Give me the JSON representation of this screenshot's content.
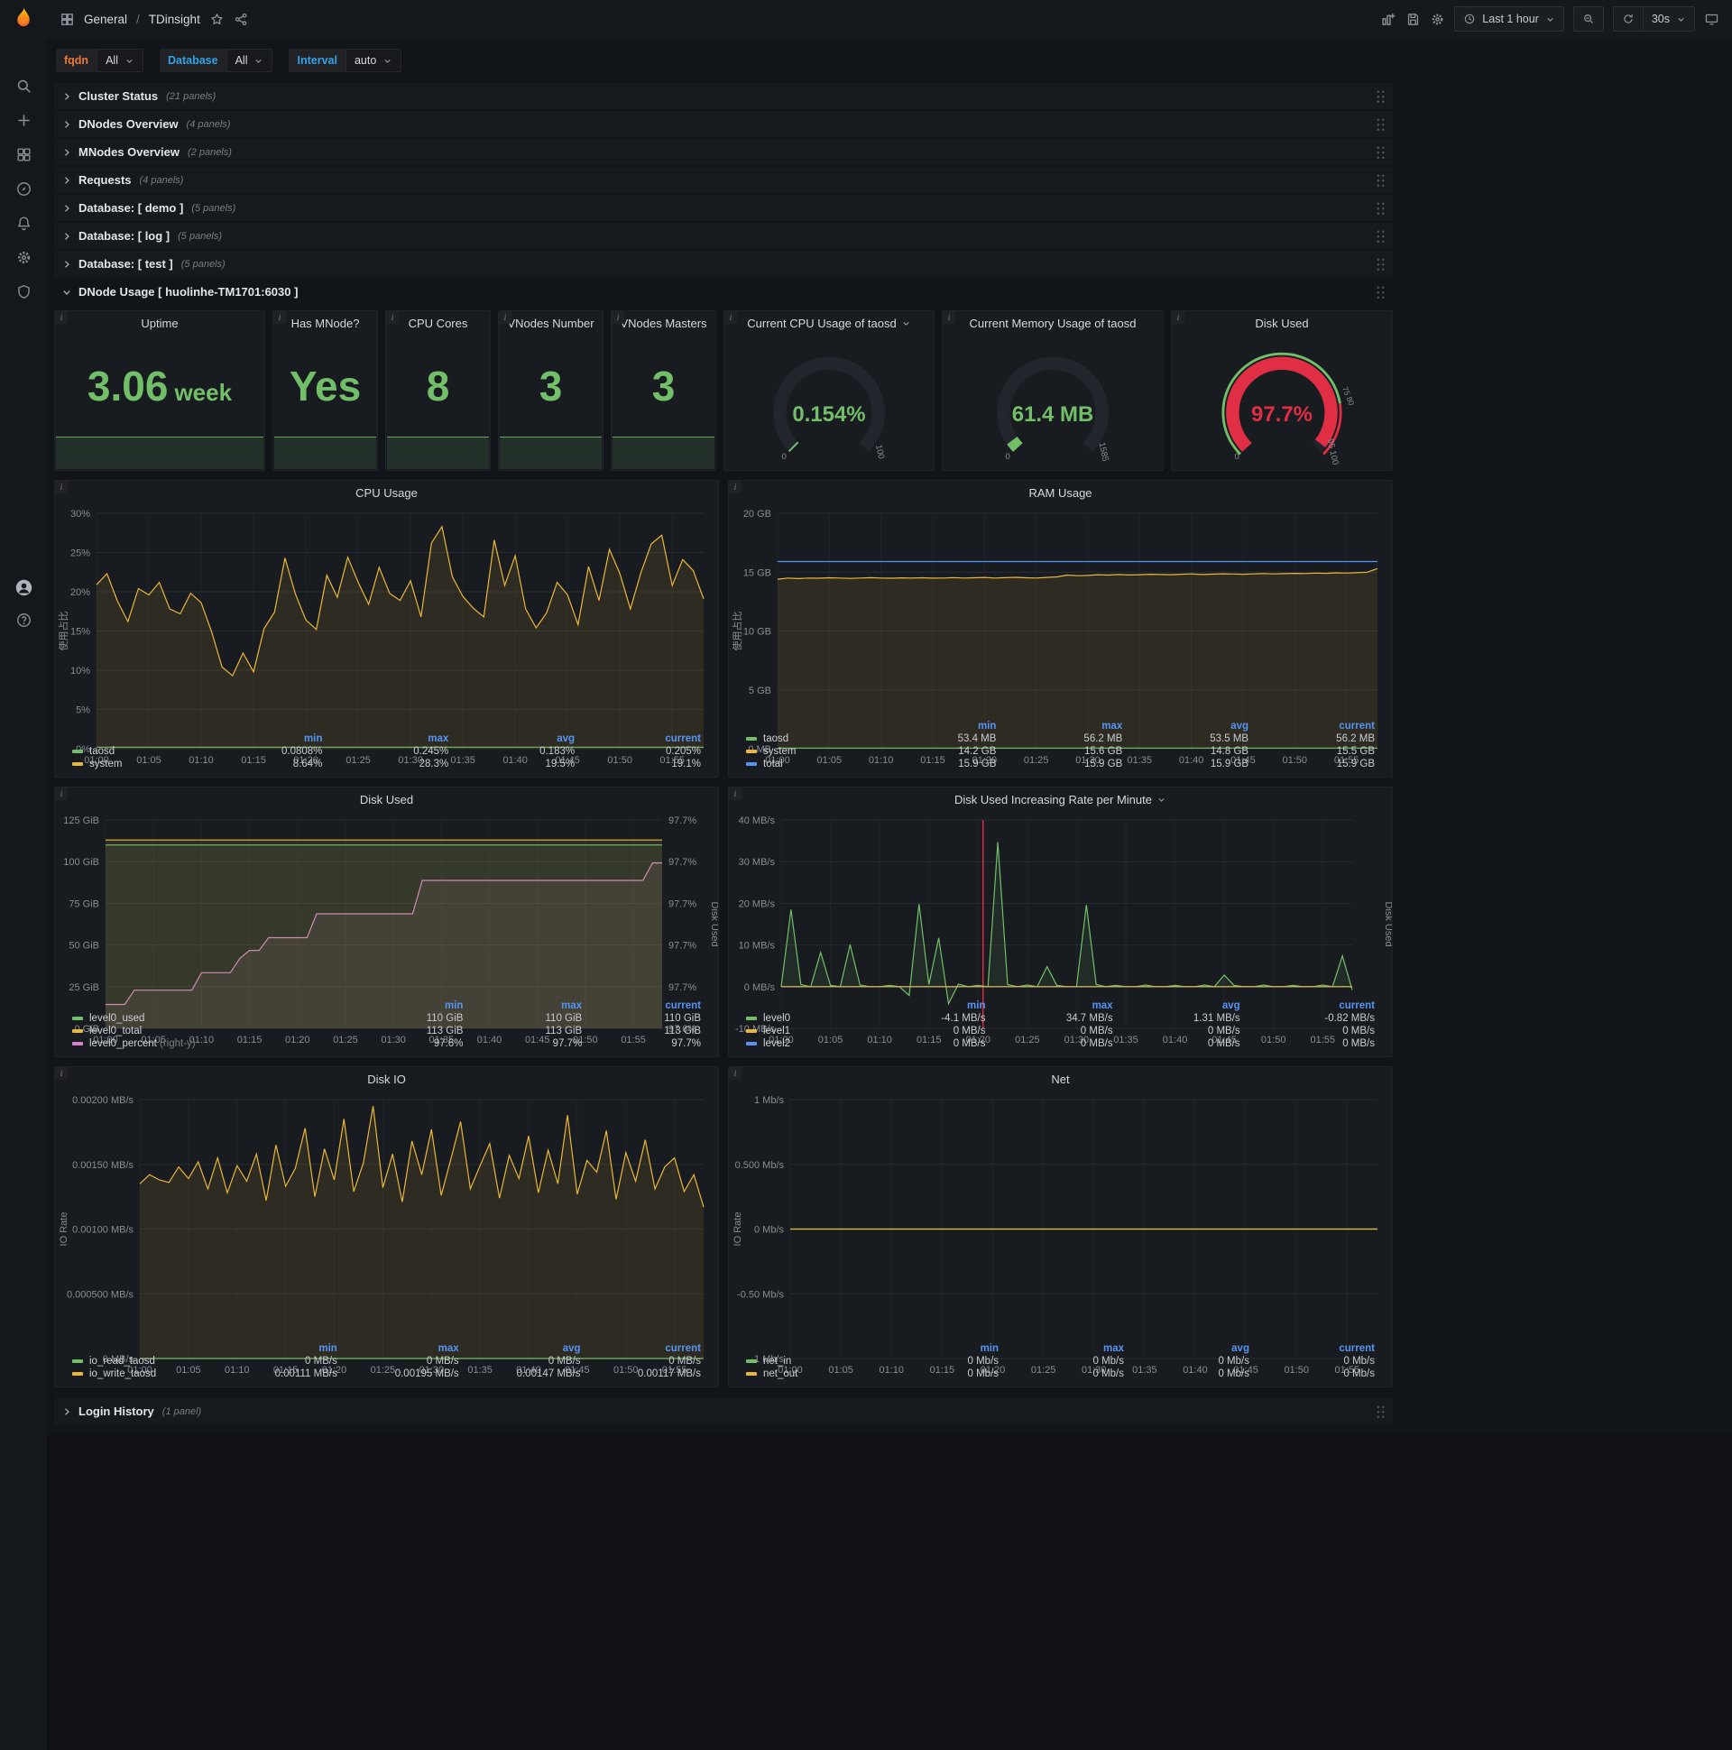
{
  "app": {
    "breadcrumb": {
      "section": "General",
      "separator": "/",
      "page": "TDinsight"
    },
    "toolbar": {
      "time_range": "Last 1 hour",
      "refresh": "30s"
    }
  },
  "variables": [
    {
      "name": "fqdn",
      "value": "All",
      "color": "#eb7b35"
    },
    {
      "name": "Database",
      "value": "All",
      "color": "#33a2e5"
    },
    {
      "name": "Interval",
      "value": "auto",
      "color": "#33a2e5"
    }
  ],
  "collapsed_rows": [
    {
      "title": "Cluster Status",
      "count": "(21 panels)"
    },
    {
      "title": "DNodes Overview",
      "count": "(4 panels)"
    },
    {
      "title": "MNodes Overview",
      "count": "(2 panels)"
    },
    {
      "title": "Requests",
      "count": "(4 panels)"
    },
    {
      "title": "Database: [ demo ]",
      "count": "(5 panels)"
    },
    {
      "title": "Database: [ log ]",
      "count": "(5 panels)"
    },
    {
      "title": "Database: [ test ]",
      "count": "(5 panels)"
    }
  ],
  "expanded_row": {
    "title": "DNode Usage [ huolinhe-TM1701:6030 ]"
  },
  "bottom_row": {
    "title": "Login History",
    "count": "(1 panel)"
  },
  "stats": [
    {
      "title": "Uptime",
      "value": "3.06",
      "suffix": "week"
    },
    {
      "title": "Has MNode?",
      "value": "Yes",
      "suffix": ""
    },
    {
      "title": "CPU Cores",
      "value": "8",
      "suffix": ""
    },
    {
      "title": "VNodes Number",
      "value": "3",
      "suffix": ""
    },
    {
      "title": "VNodes Masters",
      "value": "3",
      "suffix": ""
    }
  ],
  "gauges": [
    {
      "title": "Current CPU Usage of taosd",
      "value": "0.154%",
      "fraction": 0.008,
      "color": "#73bf69",
      "min_label": "0",
      "max_label": "100"
    },
    {
      "title": "Current Memory Usage of taosd",
      "value": "61.4 MB",
      "fraction": 0.039,
      "color": "#73bf69",
      "min_label": "0",
      "max_label": "1585"
    },
    {
      "title": "Disk Used",
      "value": "97.7%",
      "fraction": 0.977,
      "color": "#e02f44",
      "min_label": "0",
      "max_label": "95 100",
      "mid_label": "75 80",
      "threshold_band": true
    }
  ],
  "time_axis": {
    "ticks": [
      "01:00",
      "01:05",
      "01:10",
      "01:15",
      "01:20",
      "01:25",
      "01:30",
      "01:35",
      "01:40",
      "01:45",
      "01:50",
      "01:55"
    ],
    "span_minutes": 58,
    "tick_step": 5
  },
  "charts": {
    "cpu": {
      "type": "line",
      "title": "CPU Usage",
      "ylabel": "使用占比",
      "ymin": 0,
      "ymax": 30,
      "y_ticks": [
        "0%",
        "5%",
        "10%",
        "15%",
        "20%",
        "25%",
        "30%"
      ],
      "series": [
        {
          "name": "system",
          "color": "#eab839",
          "fill": true,
          "values": [
            20.9,
            22.3,
            18.8,
            16.2,
            20.4,
            19.6,
            21.2,
            17.8,
            17.2,
            19.8,
            18.6,
            14.9,
            10.4,
            9.3,
            12.2,
            9.8,
            15.3,
            17.4,
            24.3,
            19.7,
            16.4,
            15.2,
            22.1,
            19.3,
            24.4,
            21.2,
            18.4,
            23.1,
            19.8,
            18.9,
            21.4,
            16.8,
            26.2,
            28.3,
            21.9,
            19.4,
            17.9,
            16.8,
            26.6,
            20.8,
            24.6,
            17.8,
            15.4,
            17.3,
            21.2,
            19.6,
            15.8,
            23.2,
            18.9,
            25.4,
            22.3,
            17.8,
            22.4,
            26.1,
            27.2,
            20.8,
            24.1,
            22.7,
            19.1
          ]
        },
        {
          "name": "taosd",
          "color": "#73bf69",
          "flat": 0.2
        }
      ],
      "legend": {
        "cols": [
          "min",
          "max",
          "avg",
          "current"
        ],
        "rows": [
          {
            "name": "taosd",
            "color": "#73bf69",
            "vals": [
              "0.0808%",
              "0.245%",
              "0.183%",
              "0.205%"
            ]
          },
          {
            "name": "system",
            "color": "#eab839",
            "vals": [
              "8.64%",
              "28.3%",
              "19.5%",
              "19.1%"
            ]
          }
        ]
      }
    },
    "ram": {
      "type": "line",
      "title": "RAM Usage",
      "ylabel": "使用占比",
      "ymin": 0,
      "ymax": 20,
      "y_ticks": [
        "0 MB",
        "5 GB",
        "10 GB",
        "15 GB",
        "20 GB"
      ],
      "series": [
        {
          "name": "system",
          "color": "#eab839",
          "fill": true,
          "values": [
            14.4,
            14.5,
            14.45,
            14.5,
            14.48,
            14.52,
            14.5,
            14.47,
            14.5,
            14.53,
            14.5,
            14.48,
            14.51,
            14.5,
            14.52,
            14.49,
            14.5,
            14.54,
            14.5,
            14.52,
            14.55,
            14.5,
            14.53,
            14.56,
            14.52,
            14.5,
            14.55,
            14.6,
            14.75,
            14.7,
            14.72,
            14.78,
            14.75,
            14.8,
            14.76,
            14.78,
            14.82,
            14.8,
            14.78,
            14.82,
            14.85,
            14.8,
            14.83,
            14.86,
            14.84,
            14.82,
            14.85,
            14.88,
            14.85,
            14.87,
            14.9,
            14.88,
            14.92,
            14.9,
            14.94,
            14.92,
            14.95,
            15.0,
            15.3
          ]
        },
        {
          "name": "total",
          "color": "#5794f2",
          "flat": 15.9
        },
        {
          "name": "taosd",
          "color": "#73bf69",
          "flat": 0.055
        }
      ],
      "legend": {
        "cols": [
          "min",
          "max",
          "avg",
          "current"
        ],
        "rows": [
          {
            "name": "taosd",
            "color": "#73bf69",
            "vals": [
              "53.4 MB",
              "56.2 MB",
              "53.5 MB",
              "56.2 MB"
            ]
          },
          {
            "name": "system",
            "color": "#eab839",
            "vals": [
              "14.2 GB",
              "15.6 GB",
              "14.8 GB",
              "15.5 GB"
            ]
          },
          {
            "name": "total",
            "color": "#5794f2",
            "vals": [
              "15.9 GB",
              "15.9 GB",
              "15.9 GB",
              "15.9 GB"
            ]
          }
        ]
      }
    },
    "disk": {
      "type": "line",
      "title": "Disk Used",
      "ymin": 0,
      "ymax": 125,
      "y_ticks": [
        "0 GiB",
        "25 GiB",
        "50 GiB",
        "75 GiB",
        "100 GiB",
        "125 GiB"
      ],
      "y_ticks_right": [
        "97.6%",
        "97.7%",
        "97.7%",
        "97.7%",
        "97.7%",
        "97.7%"
      ],
      "right_label": "Disk Used",
      "series": [
        {
          "name": "level0_percent",
          "color": "#d683ce",
          "fill": true,
          "ymin": 97.597,
          "ymax": 97.728,
          "values": [
            97.612,
            97.612,
            97.612,
            97.621,
            97.621,
            97.621,
            97.621,
            97.621,
            97.621,
            97.621,
            97.632,
            97.632,
            97.632,
            97.632,
            97.641,
            97.646,
            97.646,
            97.654,
            97.654,
            97.654,
            97.654,
            97.654,
            97.669,
            97.669,
            97.669,
            97.669,
            97.669,
            97.669,
            97.669,
            97.669,
            97.669,
            97.669,
            97.669,
            97.69,
            97.69,
            97.69,
            97.69,
            97.69,
            97.69,
            97.69,
            97.69,
            97.69,
            97.69,
            97.69,
            97.69,
            97.69,
            97.69,
            97.69,
            97.69,
            97.69,
            97.69,
            97.69,
            97.69,
            97.69,
            97.69,
            97.69,
            97.69,
            97.701,
            97.701
          ]
        },
        {
          "name": "level0_used",
          "color": "#73bf69",
          "fill": true,
          "flat": 110
        },
        {
          "name": "level0_total",
          "color": "#eab839",
          "fill": true,
          "flat": 113
        }
      ],
      "legend": {
        "cols": [
          "min",
          "max",
          "current"
        ],
        "rows": [
          {
            "name": "level0_used",
            "color": "#73bf69",
            "vals": [
              "110 GiB",
              "110 GiB",
              "110 GiB"
            ]
          },
          {
            "name": "level0_total",
            "color": "#eab839",
            "vals": [
              "113 GiB",
              "113 GiB",
              "113 GiB"
            ]
          },
          {
            "name": "level0_percent",
            "note": "(right-y)",
            "color": "#d683ce",
            "vals": [
              "97.6%",
              "97.7%",
              "97.7%"
            ]
          }
        ]
      }
    },
    "rate": {
      "type": "line",
      "title": "Disk Used Increasing Rate per Minute",
      "ymin": -10,
      "ymax": 40,
      "y_ticks": [
        "-10 MB/s",
        "0 MB/s",
        "10 MB/s",
        "20 MB/s",
        "30 MB/s",
        "40 MB/s"
      ],
      "right_label": "Disk Used",
      "annotation_x": 20.5,
      "series": [
        {
          "name": "level0",
          "color": "#73bf69",
          "fill": true,
          "values": [
            0,
            18.5,
            0.5,
            0,
            8.2,
            0.3,
            0,
            10.1,
            0.4,
            0,
            0,
            0.3,
            0,
            -2.1,
            19.8,
            0.5,
            11.7,
            -4.1,
            0.6,
            0,
            0.3,
            0,
            34.7,
            0.5,
            0,
            0.4,
            0,
            4.8,
            0.3,
            0,
            0,
            19.6,
            0.5,
            0,
            0.3,
            0,
            0,
            0.4,
            0,
            0,
            0.3,
            0,
            0,
            0.4,
            0,
            2.8,
            0.3,
            0,
            0,
            0.4,
            0,
            0,
            0.3,
            0,
            0,
            0.4,
            0,
            7.4,
            -0.82
          ]
        },
        {
          "name": "level2",
          "color": "#5794f2",
          "flat": 0
        },
        {
          "name": "level1",
          "color": "#eab839",
          "flat": 0
        }
      ],
      "legend": {
        "cols": [
          "min",
          "max",
          "avg",
          "current"
        ],
        "rows": [
          {
            "name": "level0",
            "color": "#73bf69",
            "vals": [
              "-4.1 MB/s",
              "34.7 MB/s",
              "1.31 MB/s",
              "-0.82 MB/s"
            ]
          },
          {
            "name": "level1",
            "color": "#eab839",
            "vals": [
              "0 MB/s",
              "0 MB/s",
              "0 MB/s",
              "0 MB/s"
            ]
          },
          {
            "name": "level2",
            "color": "#5794f2",
            "vals": [
              "0 MB/s",
              "0 MB/s",
              "0 MB/s",
              "0 MB/s"
            ]
          }
        ]
      }
    },
    "diskio": {
      "type": "line",
      "title": "Disk IO",
      "ylabel": "IO Rate",
      "ymin": 0,
      "ymax": 0.002,
      "y_ticks": [
        "0 MB/s",
        "0.000500 MB/s",
        "0.00100 MB/s",
        "0.00150 MB/s",
        "0.00200 MB/s"
      ],
      "series": [
        {
          "name": "io_write_taosd",
          "color": "#eab839",
          "fill": true,
          "values": [
            0.00135,
            0.00142,
            0.00138,
            0.00136,
            0.00148,
            0.00139,
            0.00152,
            0.00131,
            0.00155,
            0.00128,
            0.00149,
            0.00137,
            0.00158,
            0.00122,
            0.00165,
            0.00133,
            0.00147,
            0.00178,
            0.00125,
            0.00162,
            0.00138,
            0.00185,
            0.00129,
            0.00151,
            0.00195,
            0.00132,
            0.00158,
            0.00121,
            0.00168,
            0.00142,
            0.00177,
            0.00126,
            0.00154,
            0.00183,
            0.00131,
            0.00149,
            0.00166,
            0.00124,
            0.00157,
            0.00139,
            0.00172,
            0.00128,
            0.00161,
            0.00135,
            0.00188,
            0.00127,
            0.00153,
            0.00144,
            0.00176,
            0.00123,
            0.00159,
            0.00137,
            0.00169,
            0.00131,
            0.00148,
            0.00155,
            0.00129,
            0.00142,
            0.00117
          ]
        },
        {
          "name": "io_read_taosd",
          "color": "#73bf69",
          "flat": 0
        }
      ],
      "legend": {
        "cols": [
          "min",
          "max",
          "avg",
          "current"
        ],
        "rows": [
          {
            "name": "io_read_taosd",
            "color": "#73bf69",
            "vals": [
              "0 MB/s",
              "0 MB/s",
              "0 MB/s",
              "0 MB/s"
            ]
          },
          {
            "name": "io_write_taosd",
            "color": "#eab839",
            "vals": [
              "0.00111 MB/s",
              "0.00195 MB/s",
              "0.00147 MB/s",
              "0.00117 MB/s"
            ]
          }
        ]
      }
    },
    "net": {
      "type": "line",
      "title": "Net",
      "ylabel": "IO Rate",
      "ymin": -1,
      "ymax": 1,
      "y_ticks": [
        "-1 Mb/s",
        "-0.50 Mb/s",
        "0 Mb/s",
        "0.500 Mb/s",
        "1 Mb/s"
      ],
      "series": [
        {
          "name": "net_in",
          "color": "#73bf69",
          "flat": 0
        },
        {
          "name": "net_out",
          "color": "#eab839",
          "flat": 0
        }
      ],
      "legend": {
        "cols": [
          "min",
          "max",
          "avg",
          "current"
        ],
        "rows": [
          {
            "name": "net_in",
            "color": "#73bf69",
            "vals": [
              "0 Mb/s",
              "0 Mb/s",
              "0 Mb/s",
              "0 Mb/s"
            ]
          },
          {
            "name": "net_out",
            "color": "#eab839",
            "vals": [
              "0 Mb/s",
              "0 Mb/s",
              "0 Mb/s",
              "0 Mb/s"
            ]
          }
        ]
      }
    }
  }
}
